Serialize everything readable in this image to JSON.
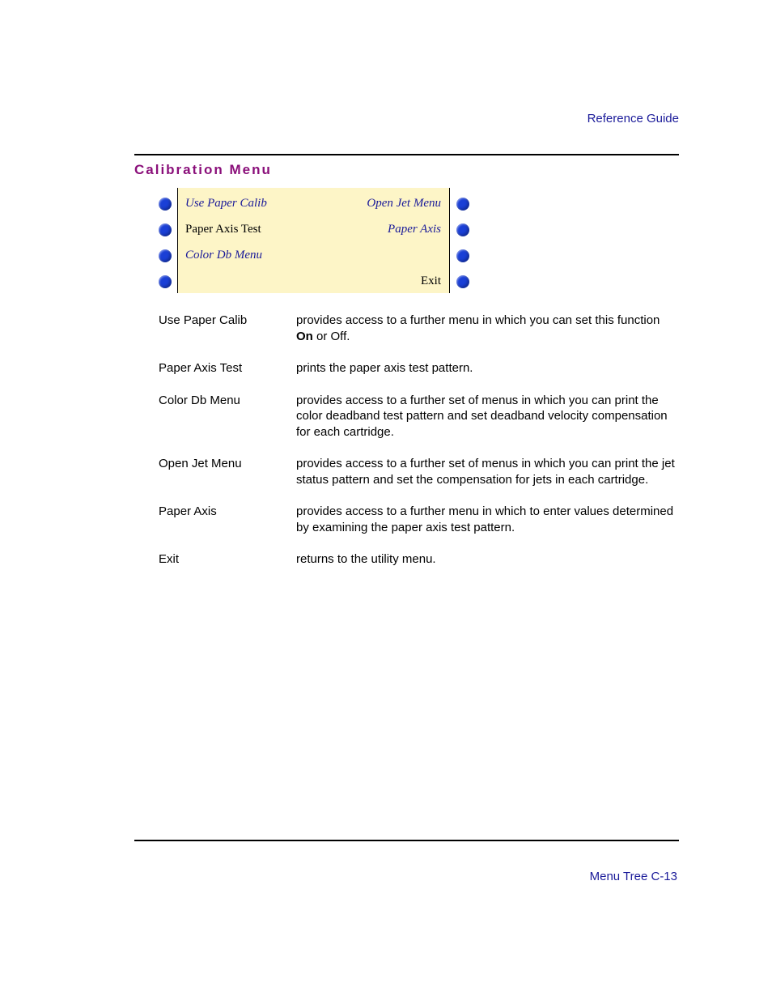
{
  "header": "Reference Guide",
  "sectionTitle": "Calibration  Menu",
  "panel": {
    "rows": [
      {
        "leftDot": true,
        "leftText": "Use Paper Calib",
        "leftItalic": true,
        "rightText": "Open Jet Menu",
        "rightItalic": true,
        "rightDot": true
      },
      {
        "leftDot": true,
        "leftText": "Paper Axis Test",
        "leftItalic": false,
        "rightText": "Paper Axis",
        "rightItalic": true,
        "rightDot": true
      },
      {
        "leftDot": true,
        "leftText": "Color Db Menu",
        "leftItalic": true,
        "rightText": "",
        "rightItalic": false,
        "rightDot": true
      },
      {
        "leftDot": true,
        "leftText": "",
        "leftItalic": false,
        "rightText": "Exit",
        "rightItalic": false,
        "rightDot": true
      }
    ]
  },
  "definitions": [
    {
      "term": "Use Paper Calib",
      "descParts": [
        {
          "text": "provides access to a further menu in which you can set this function ",
          "bold": false
        },
        {
          "text": "On",
          "bold": true
        },
        {
          "text": " or Off.",
          "bold": false
        }
      ]
    },
    {
      "term": "Paper Axis Test",
      "descParts": [
        {
          "text": "prints the paper axis test pattern.",
          "bold": false
        }
      ]
    },
    {
      "term": "Color Db Menu",
      "descParts": [
        {
          "text": "provides access to a further set of menus in which you can print the color deadband test pattern and set deadband velocity compensation for each cartridge.",
          "bold": false
        }
      ]
    },
    {
      "term": "Open Jet Menu",
      "descParts": [
        {
          "text": "provides access to a further set of menus in which you can print the jet status pattern and set the compensation for jets in each cartridge.",
          "bold": false
        }
      ]
    },
    {
      "term": "Paper Axis",
      "descParts": [
        {
          "text": "provides access to a further menu in which to enter values determined by examining the paper axis test pattern.",
          "bold": false
        }
      ]
    },
    {
      "term": "Exit",
      "descParts": [
        {
          "text": "returns to the utility menu.",
          "bold": false
        }
      ]
    }
  ],
  "footer": "Menu Tree  C-13"
}
